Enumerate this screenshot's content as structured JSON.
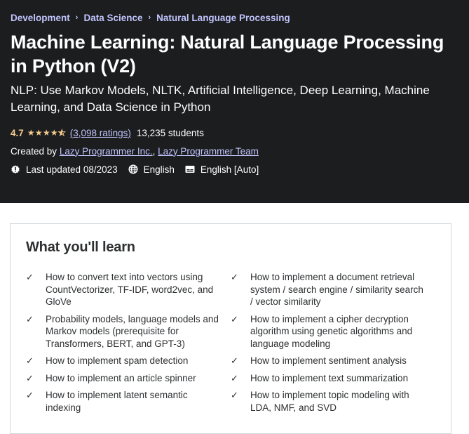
{
  "breadcrumb": [
    {
      "label": "Development"
    },
    {
      "label": "Data Science"
    },
    {
      "label": "Natural Language Processing"
    }
  ],
  "breadcrumb_separator": "›",
  "course": {
    "title": "Machine Learning: Natural Language Processing in Python (V2)",
    "subtitle": "NLP: Use Markov Models, NLTK, Artificial Intelligence, Deep Learning, Machine Learning, and Data Science in Python",
    "rating": "4.7",
    "rating_value": 4.7,
    "rating_max": 5,
    "ratings_count": "(3,098 ratings)",
    "students": "13,235 students",
    "created_by_label": "Created by",
    "instructors": [
      {
        "name": "Lazy Programmer Inc."
      },
      {
        "name": "Lazy Programmer Team"
      }
    ],
    "instructor_separator": ", ",
    "last_updated": "Last updated 08/2023",
    "language": "English",
    "captions": "English [Auto]"
  },
  "icons": {
    "last_updated": "alert-badge-icon",
    "language": "globe-icon",
    "captions": "closed-captions-icon",
    "check": "checkmark-icon",
    "star": "star-icon"
  },
  "colors": {
    "hero_bg": "#1c1d1f",
    "link": "#c0c4fc",
    "rating": "#f3ca8c",
    "text_dark": "#2d2f31",
    "border": "#d1d7dc"
  },
  "learn": {
    "title": "What you'll learn",
    "left": [
      "How to convert text into vectors using CountVectorizer, TF-IDF, word2vec, and GloVe",
      "Probability models, language models and Markov models (prerequisite for Transformers, BERT, and GPT-3)",
      "How to implement spam detection",
      "How to implement an article spinner",
      "How to implement latent semantic indexing"
    ],
    "right": [
      "How to implement a document retrieval system / search engine / similarity search / vector similarity",
      "How to implement a cipher decryption algorithm using genetic algorithms and language modeling",
      "How to implement sentiment analysis",
      "How to implement text summarization",
      "How to implement topic modeling with LDA, NMF, and SVD"
    ]
  }
}
